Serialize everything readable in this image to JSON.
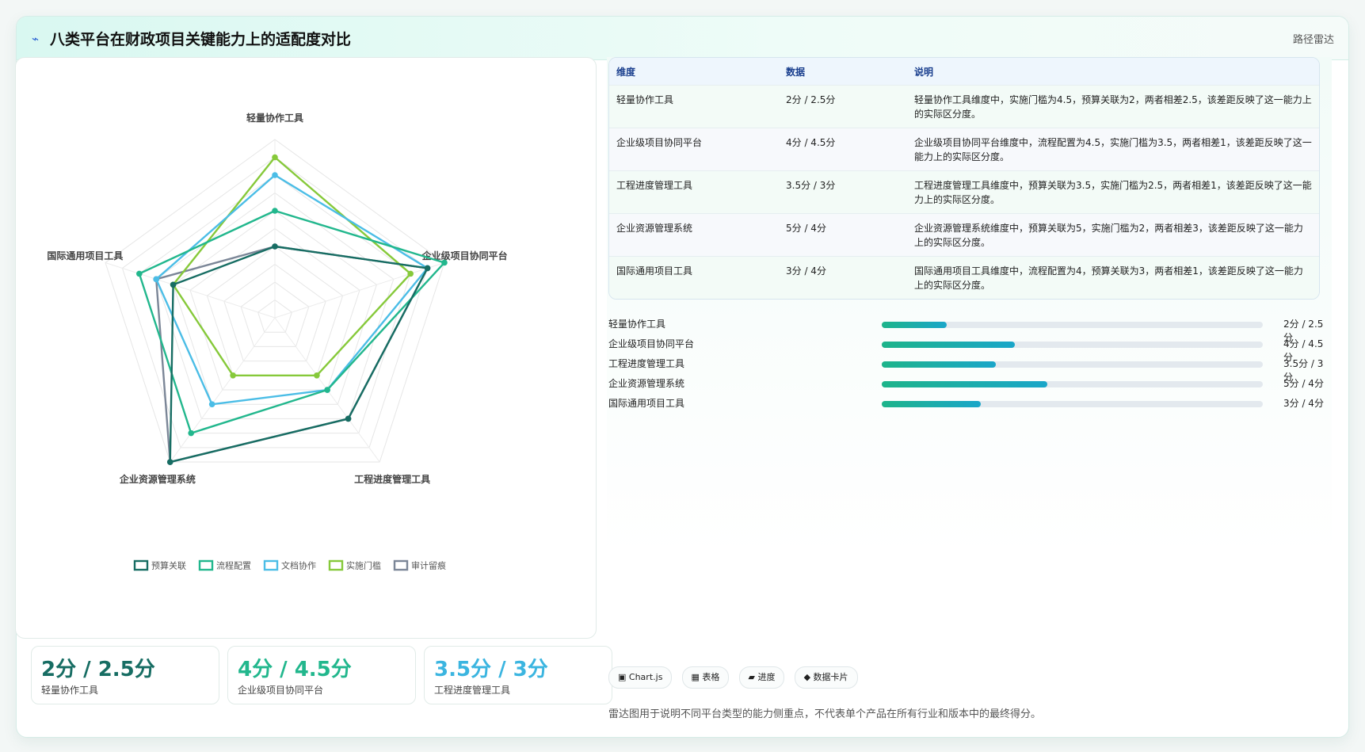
{
  "header": {
    "icon": "pulse-icon",
    "title": "八类平台在财政项目关键能力上的适配度对比",
    "tag": "路径雷达"
  },
  "colors": {
    "预算关联": "#176d63",
    "流程配置": "#22b78d",
    "文档协作": "#4bbde6",
    "实施门槛": "#86c93a",
    "审计留痕": "#7b8697"
  },
  "chart_data": {
    "type": "radar",
    "title": "",
    "axes": [
      "轻量协作工具",
      "企业级项目协同平台",
      "工程进度管理工具",
      "企业资源管理系统",
      "国际通用项目工具"
    ],
    "range": [
      0,
      5
    ],
    "grid": true,
    "legend_position": "bottom",
    "series": [
      {
        "name": "预算关联",
        "values": [
          2,
          4.5,
          3.5,
          5,
          3
        ]
      },
      {
        "name": "流程配置",
        "values": [
          3,
          5,
          2.5,
          4,
          4
        ]
      },
      {
        "name": "文档协作",
        "values": [
          4,
          4.5,
          2.5,
          3,
          3.5
        ]
      },
      {
        "name": "实施门槛",
        "values": [
          4.5,
          4,
          2,
          2,
          3
        ]
      },
      {
        "name": "审计留痕",
        "values": [
          2,
          4.5,
          3.5,
          5,
          3.5
        ]
      }
    ]
  },
  "kpis": [
    {
      "value": "2分 / 2.5分",
      "label": "轻量协作工具",
      "color": "#176d63"
    },
    {
      "value": "4分 / 4.5分",
      "label": "企业级项目协同平台",
      "color": "#22b78d"
    },
    {
      "value": "3.5分 / 3分",
      "label": "工程进度管理工具",
      "color": "#3bb5e0"
    }
  ],
  "table": {
    "headers": [
      "维度",
      "数据",
      "说明"
    ],
    "rows": [
      {
        "dim": "轻量协作工具",
        "data": "2分 / 2.5分",
        "desc": "轻量协作工具维度中，实施门槛为4.5，预算关联为2，两者相差2.5，该差距反映了这一能力上的实际区分度。"
      },
      {
        "dim": "企业级项目协同平台",
        "data": "4分 / 4.5分",
        "desc": "企业级项目协同平台维度中，流程配置为4.5，实施门槛为3.5，两者相差1，该差距反映了这一能力上的实际区分度。"
      },
      {
        "dim": "工程进度管理工具",
        "data": "3.5分 / 3分",
        "desc": "工程进度管理工具维度中，预算关联为3.5，实施门槛为2.5，两者相差1，该差距反映了这一能力上的实际区分度。"
      },
      {
        "dim": "企业资源管理系统",
        "data": "5分 / 4分",
        "desc": "企业资源管理系统维度中，预算关联为5，实施门槛为2，两者相差3，该差距反映了这一能力上的实际区分度。"
      },
      {
        "dim": "国际通用项目工具",
        "data": "3分 / 4分",
        "desc": "国际通用项目工具维度中，流程配置为4，预算关联为3，两者相差1，该差距反映了这一能力上的实际区分度。"
      }
    ]
  },
  "progress": [
    {
      "label": "轻量协作工具",
      "value": "2分 / 2.5分",
      "fraction": 0.17
    },
    {
      "label": "企业级项目协同平台",
      "value": "4分 / 4.5分",
      "fraction": 0.35
    },
    {
      "label": "工程进度管理工具",
      "value": "3.5分 / 3分",
      "fraction": 0.3
    },
    {
      "label": "企业资源管理系统",
      "value": "5分 / 4分",
      "fraction": 0.435
    },
    {
      "label": "国际通用项目工具",
      "value": "3分 / 4分",
      "fraction": 0.26
    }
  ],
  "chips": [
    {
      "icon": "chart-icon",
      "glyph": "▣",
      "label": "Chart.js"
    },
    {
      "icon": "table-icon",
      "glyph": "▦",
      "label": "表格"
    },
    {
      "icon": "progress-icon",
      "glyph": "▰",
      "label": "进度"
    },
    {
      "icon": "diamond-icon",
      "glyph": "◆",
      "label": "数据卡片"
    }
  ],
  "footnote": "雷达图用于说明不同平台类型的能力侧重点，不代表单个产品在所有行业和版本中的最终得分。"
}
